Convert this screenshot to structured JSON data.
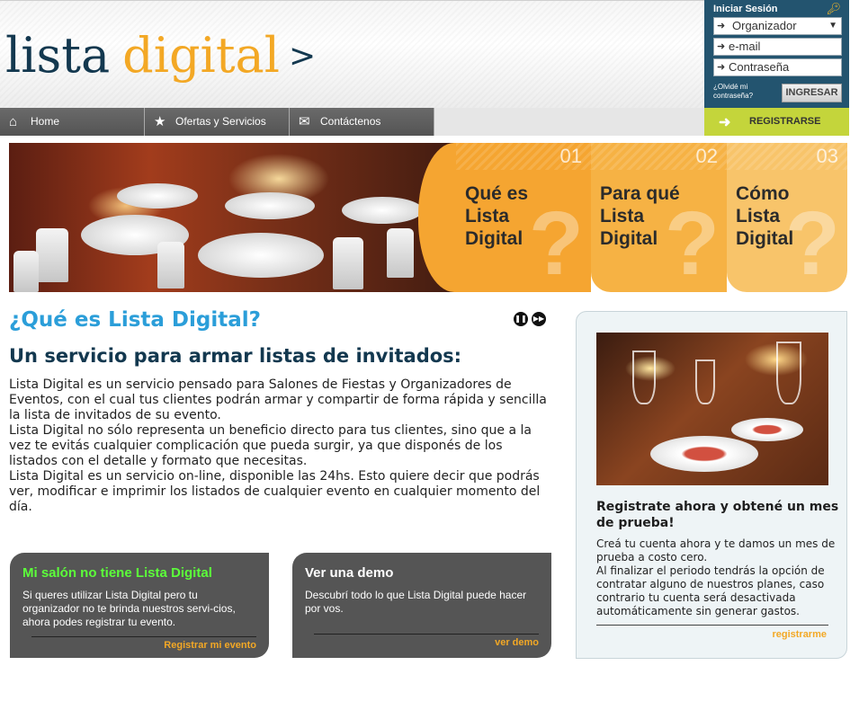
{
  "brand": {
    "word1": "lista",
    "word2": "digital",
    "arrow": ">"
  },
  "login": {
    "title": "Iniciar Sesión",
    "role_value": "Organizador",
    "email_placeholder": "e-mail",
    "password_placeholder": "Contraseña",
    "forgot_label": "¿Olvidé mi contraseña?",
    "submit_label": "INGRESAR"
  },
  "nav": {
    "items": [
      {
        "label": "Home",
        "icon": "home-icon"
      },
      {
        "label": "Ofertas y Servicios",
        "icon": "star-icon"
      },
      {
        "label": "Contáctenos",
        "icon": "envelope-icon"
      }
    ],
    "register_label": "REGISTRARSE"
  },
  "banner": {
    "panels": [
      {
        "number": "01",
        "title": "Qué es Lista Digital",
        "mark": "?"
      },
      {
        "number": "02",
        "title": "Para qué Lista Digital",
        "mark": "?"
      },
      {
        "number": "03",
        "title": "Cómo Lista Digital",
        "mark": "?"
      }
    ]
  },
  "main": {
    "heading": "¿Qué es Lista Digital?",
    "subheading": "Un servicio para armar listas de invitados:",
    "paragraphs": [
      "Lista Digital es un servicio pensado para Salones de Fiestas y Organizadores de Eventos, con el cual tus clientes podrán armar y compartir de forma rápida y sencilla la lista de invitados de su evento.",
      "Lista Digital no sólo representa un beneficio directo para tus clientes, sino que a la vez te evitás cualquier complicación que pueda surgir, ya que disponés de los listados con el detalle y formato que necesitas.",
      "Lista Digital es un servicio on-line, disponible las 24hs. Esto quiere decir que podrás ver, modificar e imprimir los listados de cualquier evento en cualquier momento del día."
    ]
  },
  "promo_left": {
    "title": "Mi salón no tiene Lista Digital",
    "body": "Si queres utilizar Lista Digital pero tu organizador no te brinda nuestros servi-cios, ahora podes registrar tu evento.",
    "link": "Registrar mi evento"
  },
  "promo_demo": {
    "title": "Ver una demo",
    "body": "Descubrí todo lo que Lista Digital puede hacer por vos.",
    "link": "ver demo"
  },
  "card": {
    "title": "Registrate ahora y obtené un mes de prueba!",
    "body1": "Creá tu cuenta ahora y te damos un mes de prueba a costo cero.",
    "body2": "Al finalizar el periodo tendrás la opción de contratar alguno de nuestros planes, caso contrario tu cuenta será desactivada automáticamente sin generar gastos.",
    "link": "registrarme"
  },
  "colors": {
    "accent_blue": "#2b9ed9",
    "navy": "#13384f",
    "orange": "#f3a825",
    "lime": "#c4d53b",
    "promo_green": "#5cff3a"
  }
}
